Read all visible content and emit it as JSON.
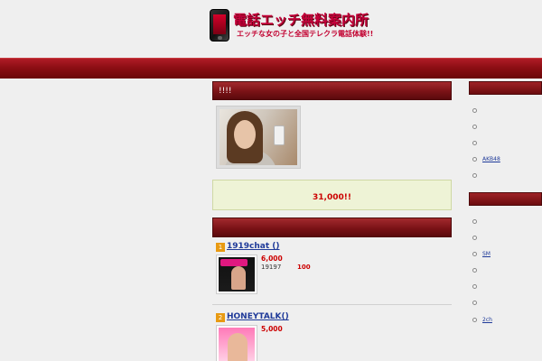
{
  "header": {
    "logo_title": "電話エッチ無料案内所",
    "logo_subtitle": "エッチな女の子と全国テレクラ電話体験!!"
  },
  "main": {
    "box_heading": "!!!!",
    "promo_text": "31,000!!",
    "ranking": [
      {
        "rank": "1",
        "name": "1919chat ()",
        "price": "6,000",
        "note": "19197",
        "note_value": "100"
      },
      {
        "rank": "2",
        "name": "HONEYTALK()",
        "price": "5,000",
        "note": "",
        "note_value": ""
      }
    ]
  },
  "sidebar": {
    "section1": [
      "",
      "",
      "",
      "AKB48",
      ""
    ],
    "section2": [
      "",
      "",
      "SM",
      "",
      "",
      "",
      "2ch"
    ]
  }
}
